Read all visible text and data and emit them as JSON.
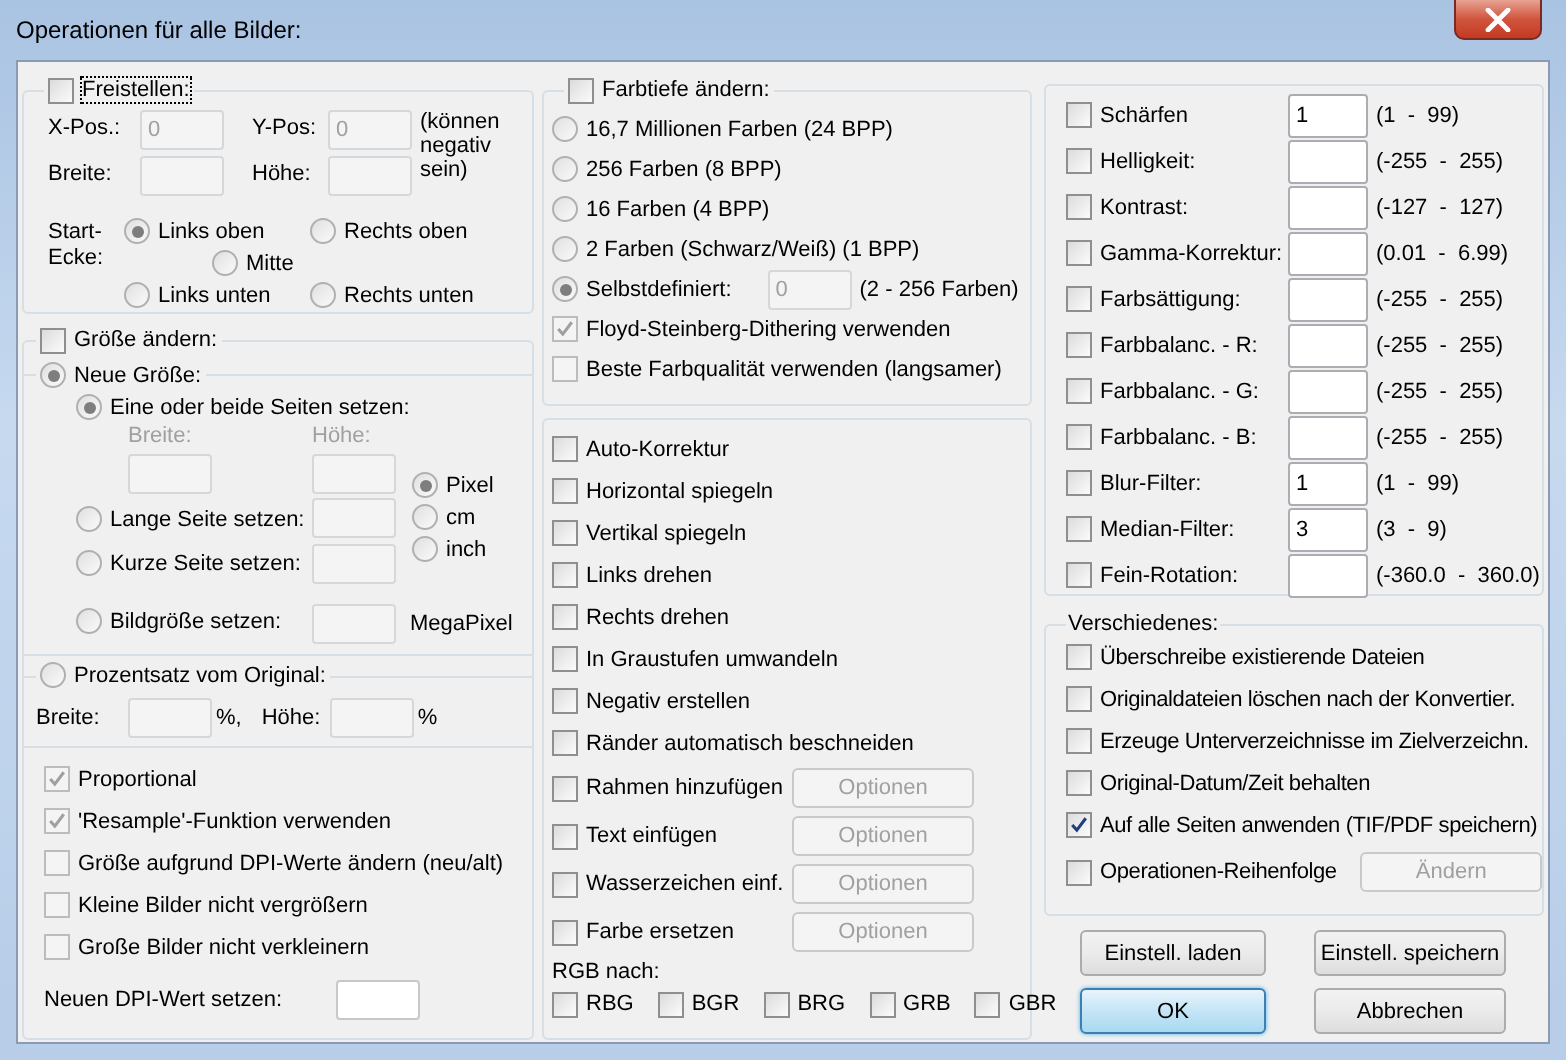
{
  "window": {
    "title": "Operationen für alle Bilder:"
  },
  "crop": {
    "label": "Freistellen:",
    "checked": false,
    "focused": true,
    "x_label": "X-Pos.:",
    "x_value": "0",
    "y_label": "Y-Pos:",
    "y_value": "0",
    "note": "(können negativ sein)",
    "width_label": "Breite:",
    "height_label": "Höhe:",
    "corner_label": "Start-Ecke:",
    "corners": [
      {
        "label": "Links oben",
        "selected": true
      },
      {
        "label": "Rechts oben",
        "selected": false
      },
      {
        "label": "Mitte",
        "selected": false
      },
      {
        "label": "Links unten",
        "selected": false
      },
      {
        "label": "Rechts unten",
        "selected": false
      }
    ]
  },
  "resize": {
    "label": "Größe ändern:",
    "checked": false,
    "new_size": {
      "label": "Neue Größe:",
      "selected": true
    },
    "sides": {
      "label": "Eine oder beide Seiten setzen:",
      "selected": true
    },
    "width_label": "Breite:",
    "height_label": "Höhe:",
    "long_side": {
      "label": "Lange Seite setzen:",
      "selected": false
    },
    "short_side": {
      "label": "Kurze Seite setzen:",
      "selected": false
    },
    "units": [
      {
        "label": "Pixel",
        "selected": true
      },
      {
        "label": "cm",
        "selected": false
      },
      {
        "label": "inch",
        "selected": false
      }
    ],
    "megapixel": {
      "label": "Bildgröße setzen:",
      "selected": false,
      "unit": "MegaPixel"
    },
    "percent": {
      "label": "Prozentsatz vom Original:",
      "selected": false,
      "width_label": "Breite:",
      "width_unit": "%,",
      "height_label": "Höhe:",
      "height_unit": "%"
    },
    "options": [
      {
        "label": "Proportional",
        "checked": true
      },
      {
        "label": "'Resample'-Funktion verwenden",
        "checked": true
      },
      {
        "label": "Größe aufgrund DPI-Werte ändern (neu/alt)",
        "checked": false
      },
      {
        "label": "Kleine Bilder nicht vergrößern",
        "checked": false
      },
      {
        "label": "Große Bilder nicht verkleinern",
        "checked": false
      }
    ],
    "dpi_label": "Neuen DPI-Wert setzen:"
  },
  "color_depth": {
    "label": "Farbtiefe ändern:",
    "checked": false,
    "options": [
      {
        "label": "16,7 Millionen Farben (24 BPP)",
        "selected": false
      },
      {
        "label": "256 Farben (8 BPP)",
        "selected": false
      },
      {
        "label": "16 Farben (4 BPP)",
        "selected": false
      },
      {
        "label": "2 Farben (Schwarz/Weiß) (1 BPP)",
        "selected": false
      },
      {
        "label": "Selbstdefiniert:",
        "selected": true,
        "value": "0",
        "range": "(2 - 256 Farben)"
      }
    ],
    "checks": [
      {
        "label": "Floyd-Steinberg-Dithering verwenden",
        "checked": true
      },
      {
        "label": "Beste Farbqualität verwenden (langsamer)",
        "checked": false
      }
    ]
  },
  "operations": [
    {
      "label": "Auto-Korrektur",
      "checked": false
    },
    {
      "label": "Horizontal spiegeln",
      "checked": false
    },
    {
      "label": "Vertikal spiegeln",
      "checked": false
    },
    {
      "label": "Links drehen",
      "checked": false
    },
    {
      "label": "Rechts drehen",
      "checked": false
    },
    {
      "label": "In Graustufen umwandeln",
      "checked": false
    },
    {
      "label": "Negativ erstellen",
      "checked": false
    },
    {
      "label": "Ränder automatisch beschneiden",
      "checked": false
    },
    {
      "label": "Rahmen hinzufügen",
      "checked": false,
      "button": "Optionen"
    },
    {
      "label": "Text einfügen",
      "checked": false,
      "button": "Optionen"
    },
    {
      "label": "Wasserzeichen einf.",
      "checked": false,
      "button": "Optionen"
    },
    {
      "label": "Farbe ersetzen",
      "checked": false,
      "button": "Optionen"
    }
  ],
  "rgb_label": "RGB nach:",
  "rgb": [
    {
      "label": "RBG",
      "checked": false
    },
    {
      "label": "BGR",
      "checked": false
    },
    {
      "label": "BRG",
      "checked": false
    },
    {
      "label": "GRB",
      "checked": false
    },
    {
      "label": "GBR",
      "checked": false
    }
  ],
  "adjustments": [
    {
      "label": "Schärfen",
      "checked": false,
      "value": "1",
      "range": "(1  -  99)"
    },
    {
      "label": "Helligkeit:",
      "checked": false,
      "range": "(-255  -  255)"
    },
    {
      "label": "Kontrast:",
      "checked": false,
      "range": "(-127  -  127)"
    },
    {
      "label": "Gamma-Korrektur:",
      "checked": false,
      "range": "(0.01  -  6.99)"
    },
    {
      "label": "Farbsättigung:",
      "checked": false,
      "range": "(-255  -  255)"
    },
    {
      "label": "Farbbalanc. - R:",
      "checked": false,
      "range": "(-255  -  255)"
    },
    {
      "label": "Farbbalanc. - G:",
      "checked": false,
      "range": "(-255  -  255)"
    },
    {
      "label": "Farbbalanc. - B:",
      "checked": false,
      "range": "(-255  -  255)"
    },
    {
      "label": "Blur-Filter:",
      "checked": false,
      "value": "1",
      "range": "(1  -  99)"
    },
    {
      "label": "Median-Filter:",
      "checked": false,
      "value": "3",
      "range": "(3  -  9)"
    },
    {
      "label": "Fein-Rotation:",
      "checked": false,
      "range": "(-360.0  -  360.0)"
    }
  ],
  "misc": {
    "title": "Verschiedenes:",
    "options": [
      {
        "label": "Überschreibe existierende Dateien",
        "checked": false
      },
      {
        "label": "Originaldateien löschen nach der Konvertier.",
        "checked": false
      },
      {
        "label": "Erzeuge Unterverzeichnisse im Zielverzeichn.",
        "checked": false
      },
      {
        "label": "Original-Datum/Zeit behalten",
        "checked": false
      },
      {
        "label": "Auf alle Seiten anwenden (TIF/PDF speichern)",
        "checked": true
      }
    ],
    "order": {
      "label": "Operationen-Reihenfolge",
      "checked": false,
      "button": "Ändern"
    }
  },
  "buttons": [
    {
      "label": "Einstell. laden",
      "default": false
    },
    {
      "label": "Einstell. speichern",
      "default": false
    },
    {
      "label": "OK",
      "default": true
    },
    {
      "label": "Abbrechen",
      "default": false
    }
  ]
}
